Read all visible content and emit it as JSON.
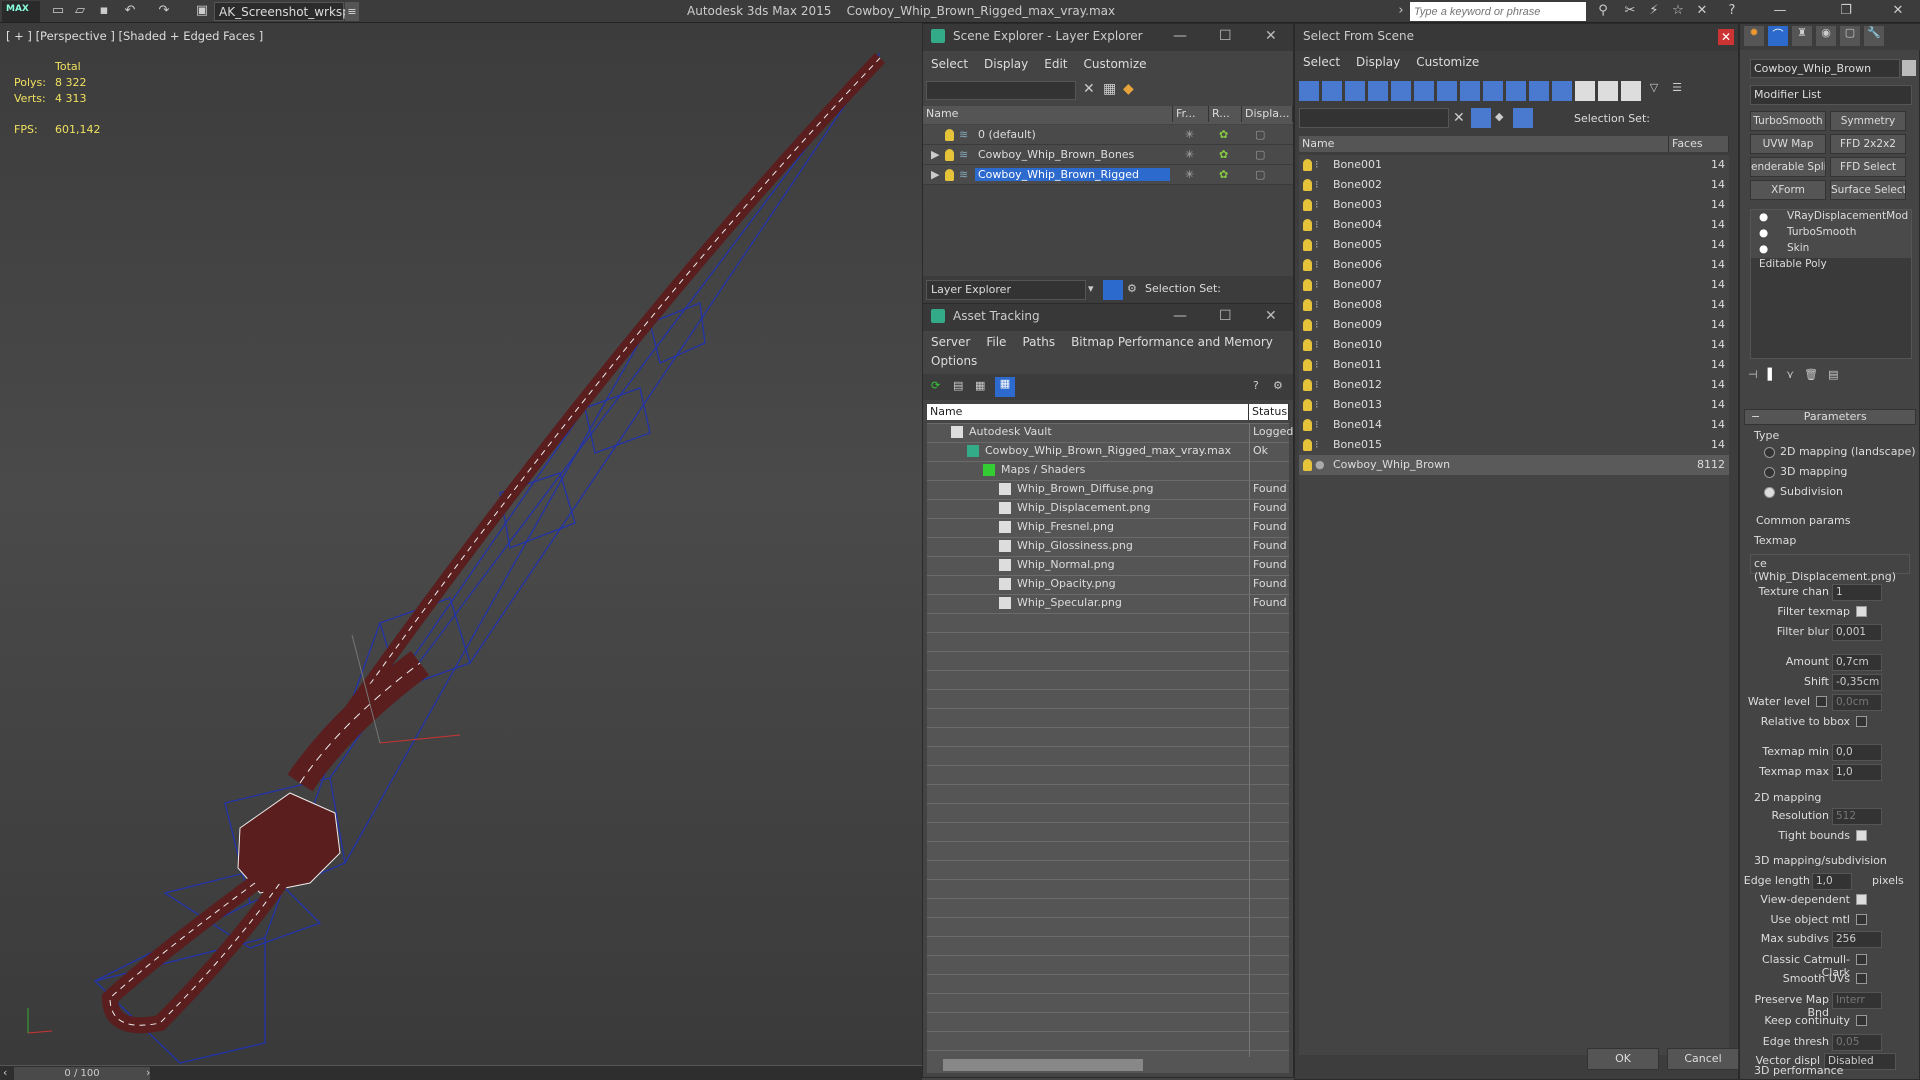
{
  "titlebar": {
    "logo": "MAX",
    "workspace": "AK_Screenshot_wrksp",
    "app_name": "Autodesk 3ds Max  2015",
    "file_name": "Cowboy_Whip_Brown_Rigged_max_vray.max",
    "search_placeholder": "Type a keyword or phrase"
  },
  "viewport": {
    "label": "[ + ] [Perspective ] [Shaded + Edged Faces ]",
    "stats": {
      "total_label": "Total",
      "polys_label": "Polys:",
      "polys": "8 322",
      "verts_label": "Verts:",
      "verts": "4 313",
      "fps_label": "FPS:",
      "fps": "601,142"
    },
    "time": "0 / 100"
  },
  "scene_explorer": {
    "title": "Scene Explorer - Layer Explorer",
    "menus": [
      "Select",
      "Display",
      "Edit",
      "Customize"
    ],
    "columns": [
      "Name",
      "Fr...",
      "R...",
      "Displa..."
    ],
    "rows": [
      {
        "name": "0 (default)",
        "selected": false,
        "expand": ""
      },
      {
        "name": "Cowboy_Whip_Brown_Bones",
        "selected": false,
        "expand": "▶"
      },
      {
        "name": "Cowboy_Whip_Brown_Rigged",
        "selected": true,
        "expand": "▶"
      }
    ],
    "footer_dropdown": "Layer Explorer",
    "selection_set_label": "Selection Set:"
  },
  "asset_tracking": {
    "title": "Asset Tracking",
    "menus": [
      "Server",
      "File",
      "Paths",
      "Bitmap Performance and Memory"
    ],
    "menus2": [
      "Options"
    ],
    "columns": [
      "Name",
      "Status"
    ],
    "rows": [
      {
        "name": "Autodesk Vault",
        "status": "Logged",
        "indent": 0
      },
      {
        "name": "Cowboy_Whip_Brown_Rigged_max_vray.max",
        "status": "Ok",
        "indent": 1
      },
      {
        "name": "Maps / Shaders",
        "status": "",
        "indent": 2
      },
      {
        "name": "Whip_Brown_Diffuse.png",
        "status": "Found",
        "indent": 3
      },
      {
        "name": "Whip_Displacement.png",
        "status": "Found",
        "indent": 3
      },
      {
        "name": "Whip_Fresnel.png",
        "status": "Found",
        "indent": 3
      },
      {
        "name": "Whip_Glossiness.png",
        "status": "Found",
        "indent": 3
      },
      {
        "name": "Whip_Normal.png",
        "status": "Found",
        "indent": 3
      },
      {
        "name": "Whip_Opacity.png",
        "status": "Found",
        "indent": 3
      },
      {
        "name": "Whip_Specular.png",
        "status": "Found",
        "indent": 3
      }
    ]
  },
  "select_from_scene": {
    "title": "Select From Scene",
    "menus": [
      "Select",
      "Display",
      "Customize"
    ],
    "selection_set_label": "Selection Set:",
    "columns": [
      "Name",
      "Faces"
    ],
    "rows": [
      {
        "name": "Bone001",
        "faces": "14"
      },
      {
        "name": "Bone002",
        "faces": "14"
      },
      {
        "name": "Bone003",
        "faces": "14"
      },
      {
        "name": "Bone004",
        "faces": "14"
      },
      {
        "name": "Bone005",
        "faces": "14"
      },
      {
        "name": "Bone006",
        "faces": "14"
      },
      {
        "name": "Bone007",
        "faces": "14"
      },
      {
        "name": "Bone008",
        "faces": "14"
      },
      {
        "name": "Bone009",
        "faces": "14"
      },
      {
        "name": "Bone010",
        "faces": "14"
      },
      {
        "name": "Bone011",
        "faces": "14"
      },
      {
        "name": "Bone012",
        "faces": "14"
      },
      {
        "name": "Bone013",
        "faces": "14"
      },
      {
        "name": "Bone014",
        "faces": "14"
      },
      {
        "name": "Bone015",
        "faces": "14"
      },
      {
        "name": "Cowboy_Whip_Brown",
        "faces": "8112"
      }
    ],
    "ok": "OK",
    "cancel": "Cancel"
  },
  "command_panel": {
    "object_name": "Cowboy_Whip_Brown",
    "modifier_list": "Modifier List",
    "buttons": [
      "TurboSmooth",
      "Symmetry",
      "UVW Map",
      "FFD 2x2x2",
      "enderable Splir",
      "FFD Select",
      "XForm",
      "Surface Select"
    ],
    "stack": [
      "VRayDisplacementMod",
      "TurboSmooth",
      "Skin",
      "Editable Poly"
    ],
    "rollout": "Parameters",
    "type_label": "Type",
    "type_options": [
      "2D mapping (landscape)",
      "3D mapping",
      "Subdivision"
    ],
    "common_params": "Common params",
    "texmap_label": "Texmap",
    "texmap_value": "ce (Whip_Displacement.png)",
    "texture_chan_label": "Texture chan",
    "texture_chan": "1",
    "filter_texmap_label": "Filter texmap",
    "filter_blur_label": "Filter blur",
    "filter_blur": "0,001",
    "amount_label": "Amount",
    "amount": "0,7cm",
    "shift_label": "Shift",
    "shift": "-0,35cm",
    "water_level_label": "Water level",
    "water_level": "0,0cm",
    "relative_bbox_label": "Relative to bbox",
    "texmap_min_label": "Texmap min",
    "texmap_min": "0,0",
    "texmap_max_label": "Texmap max",
    "texmap_max": "1,0",
    "mapping2d": "2D mapping",
    "resolution_label": "Resolution",
    "resolution": "512",
    "tight_bounds_label": "Tight bounds",
    "mapping3d": "3D mapping/subdivision",
    "edge_length_label": "Edge length",
    "edge_length": "1,0",
    "pixels_label": "pixels",
    "view_dependent_label": "View-dependent",
    "use_object_mtl_label": "Use object mtl",
    "max_subdivs_label": "Max subdivs",
    "max_subdivs": "256",
    "classic_cc_label": "Classic Catmull-Clark",
    "smooth_uvs_label": "Smooth UVs",
    "preserve_map_label": "Preserve Map Bnd",
    "preserve_map": "Interr",
    "keep_continuity_label": "Keep continuity",
    "edge_thresh_label": "Edge thresh",
    "edge_thresh": "0,05",
    "vector_displ_label": "Vector displ",
    "vector_displ": "Disabled",
    "perf_label": "3D performance"
  }
}
